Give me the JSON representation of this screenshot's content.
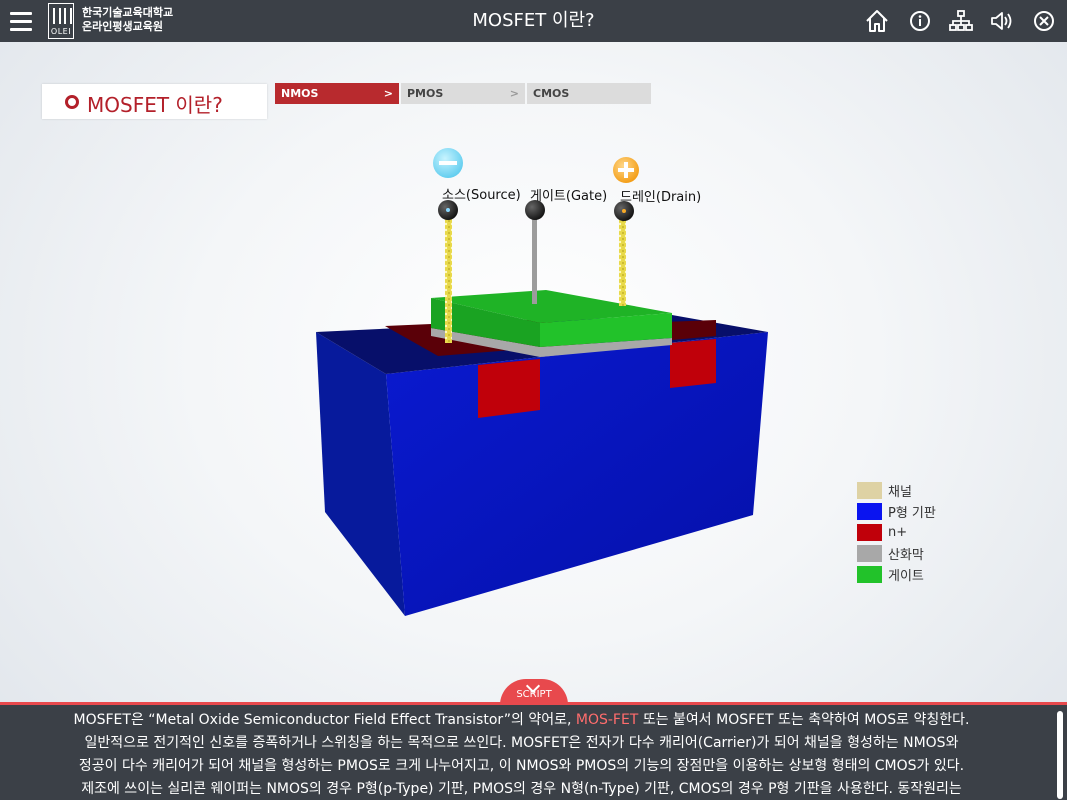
{
  "header": {
    "menu_icon": "hamburger-menu-icon",
    "logo_text": "OLEI",
    "org_line1": "한국기술교육대학교",
    "org_line2": "온라인평생교육원",
    "title": "MOSFET 이란?",
    "icons": [
      "home-icon",
      "info-icon",
      "sitemap-icon",
      "sound-icon",
      "close-icon"
    ]
  },
  "section": {
    "title": "MOSFET 이란?"
  },
  "tabs": [
    {
      "label": "NMOS",
      "arrow": ">",
      "active": true
    },
    {
      "label": "PMOS",
      "arrow": ">",
      "active": false
    },
    {
      "label": "CMOS",
      "active": false
    }
  ],
  "diagram": {
    "source_label": "소스(Source)",
    "gate_label": "게이트(Gate)",
    "drain_label": "드레인(Drain)",
    "colors": {
      "substrate": "#0a14c8",
      "n_plus": "#c0000a",
      "gate": "#22c22a",
      "oxide": "#a8a8a8",
      "channel": "#e2cf8c",
      "minus_charge": "#78dcf6",
      "plus_charge": "#f7a927"
    }
  },
  "legend": [
    {
      "label": "채널",
      "color": "#ded2a4"
    },
    {
      "label": "P형 기판",
      "color": "#0a14f0"
    },
    {
      "label": "n+",
      "color": "#c0000a"
    },
    {
      "label": "산화막",
      "color": "#a8a8a8"
    },
    {
      "label": "게이트",
      "color": "#22c22a"
    }
  ],
  "script": {
    "tab_label": "SCRIPT",
    "line1_a": "MOSFET은 “Metal Oxide Semiconductor Field Effect Transistor”의 약어로, ",
    "line1_highlight": "MOS-FET",
    "line1_b": " 또는 붙여서 MOSFET 또는 축약하여 MOS로 약칭한다.",
    "line2": "일반적으로 전기적인 신호를 증폭하거나 스위칭을 하는 목적으로 쓰인다. MOSFET은 전자가 다수 캐리어(Carrier)가 되어 채널을 형성하는 NMOS와",
    "line3": "정공이 다수 캐리어가 되어 채널을 형성하는 PMOS로 크게 나누어지고, 이 NMOS와 PMOS의 기능의 장점만을 이용하는 상보형 형태의 CMOS가 있다.",
    "line4": "제조에 쓰이는 실리콘 웨이퍼는 NMOS의 경우 P형(p-Type) 기판, PMOS의 경우 N형(n-Type) 기판, CMOS의 경우 P형 기판을 사용한다. 동작원리는",
    "highlight_color": "#ff6d6d"
  }
}
